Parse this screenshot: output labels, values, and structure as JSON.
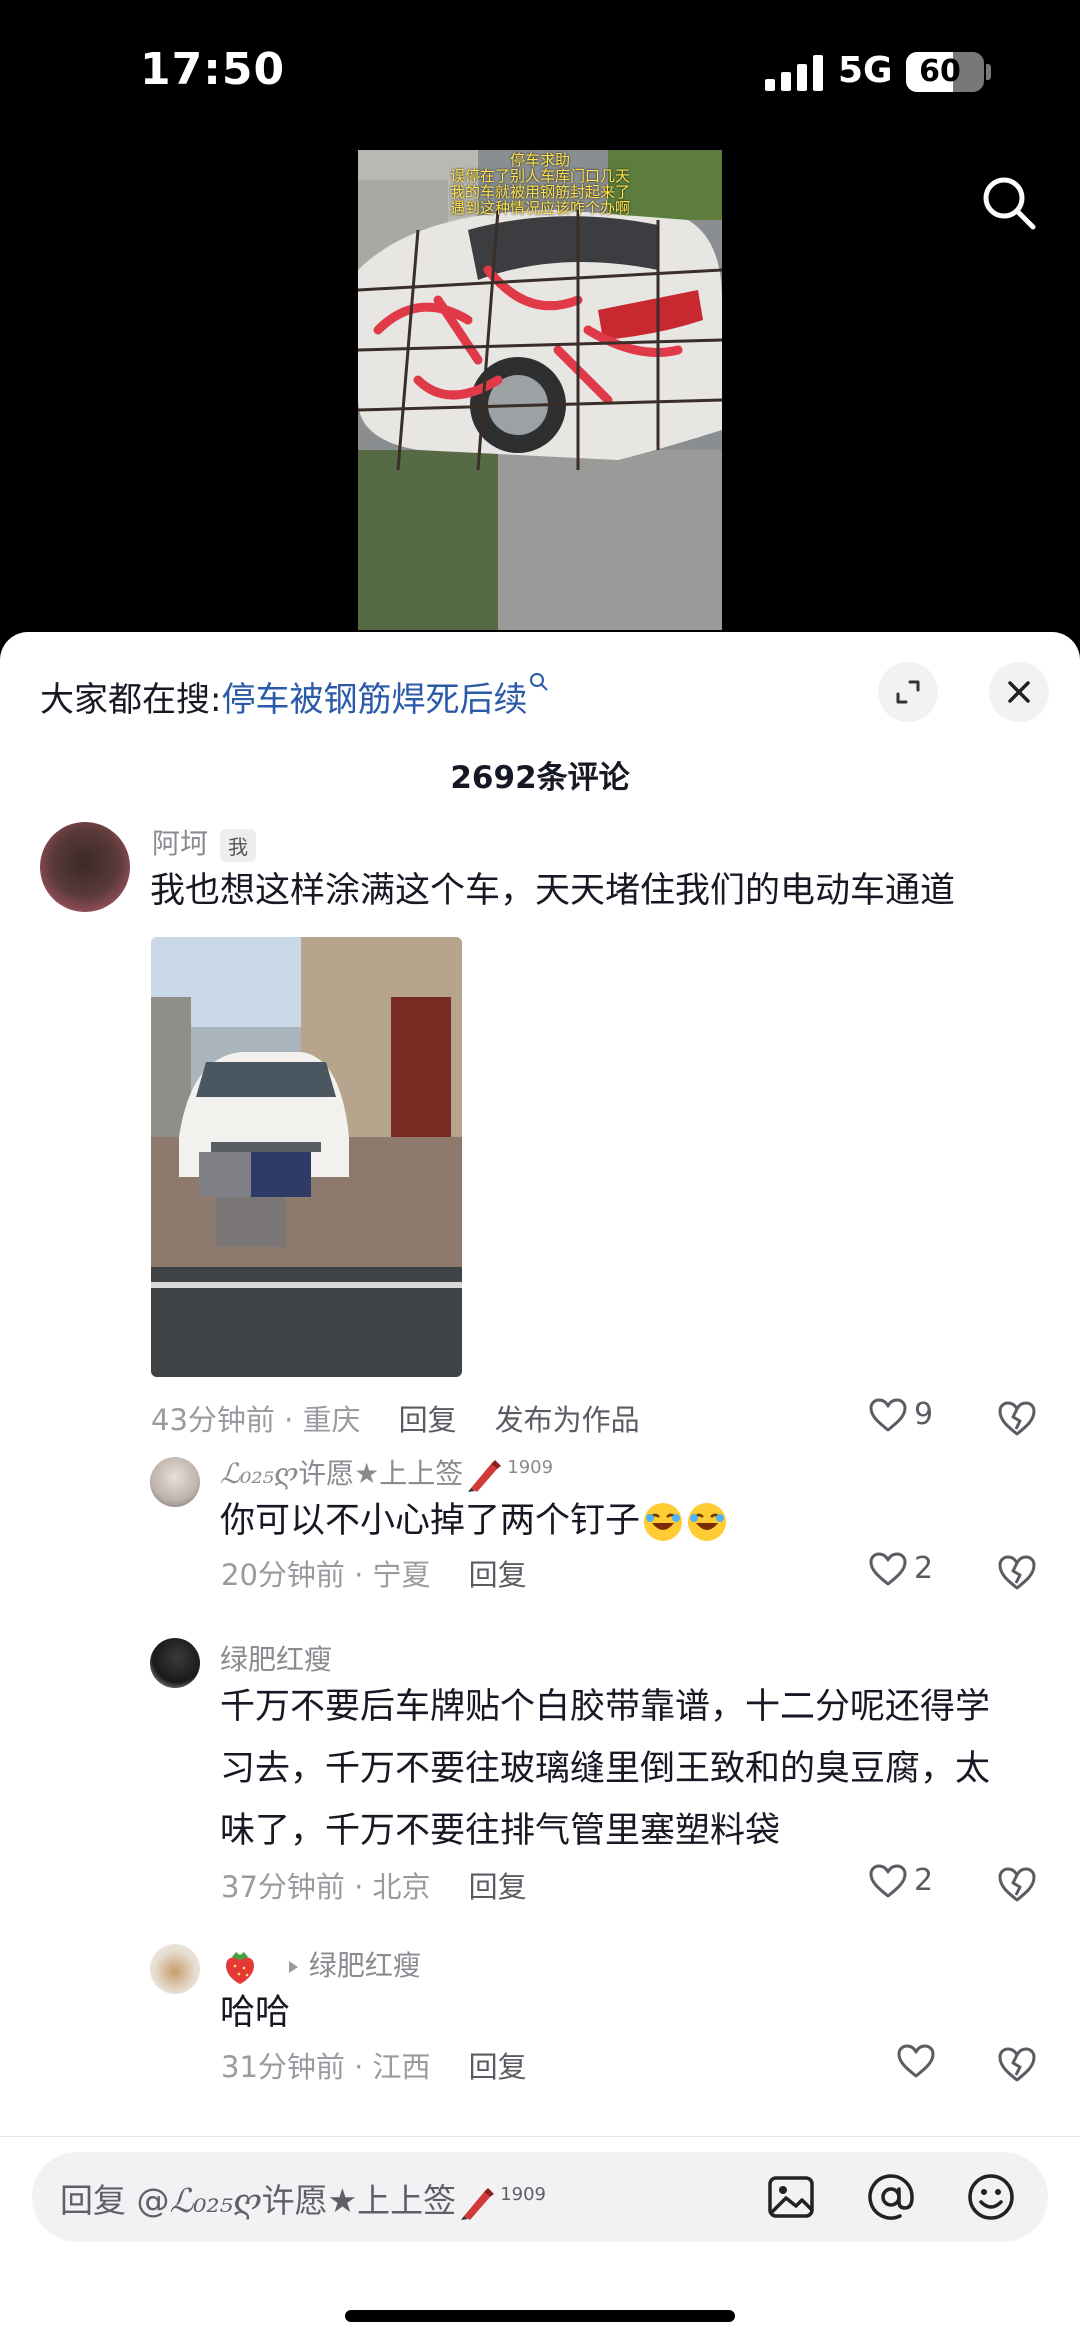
{
  "status_bar": {
    "time": "17:50",
    "network": "5G",
    "battery": "60"
  },
  "video": {
    "caption_lines": [
      "停车求助",
      "误停在了别人车库门口几天",
      "我的车就被用钢筋封起来了",
      "遇到这种情况应该咋个办啊"
    ],
    "search_icon": "search-icon"
  },
  "sheet": {
    "trending_label": "大家都在搜:",
    "trending_keyword": "停车被钢筋焊死后续",
    "title": "2692条评论"
  },
  "comments": [
    {
      "username": "阿坷",
      "badge": "我",
      "text": "我也想这样涂满这个车，天天堵住我们的电动车通道",
      "time_location": "43分钟前 · 重庆",
      "reply": "回复",
      "publish": "发布为作品",
      "likes": "9"
    },
    {
      "username_script": "ℒ₀₂₅ღ",
      "username": "许愿★上上签",
      "username_sup": "1909",
      "text": "你可以不小心掉了两个钉子",
      "time_location": "20分钟前 · 宁夏",
      "reply": "回复",
      "likes": "2"
    },
    {
      "username": "绿肥红瘦",
      "text_lines": [
        "千万不要后车牌贴个白胶带靠谱，十二分呢还得学",
        "习去，千万不要往玻璃缝里倒王致和的臭豆腐，太",
        "味了，千万不要往排气管里塞塑料袋"
      ],
      "time_location": "37分钟前 · 北京",
      "reply": "回复",
      "likes": "2"
    },
    {
      "username": "绿肥红瘦",
      "text": "哈哈",
      "time_location": "31分钟前 · 江西",
      "reply": "回复",
      "likes": ""
    }
  ],
  "reply_bar": {
    "prefix": "回复 @",
    "target_script": "ℒ₀₂₅ღ",
    "target": "许愿★上上签",
    "target_sup": "1909"
  },
  "colors": {
    "accent_link": "#2a5aa8",
    "text": "#161823",
    "muted": "#9a9ba1",
    "sheet_bg": "#ffffff"
  }
}
